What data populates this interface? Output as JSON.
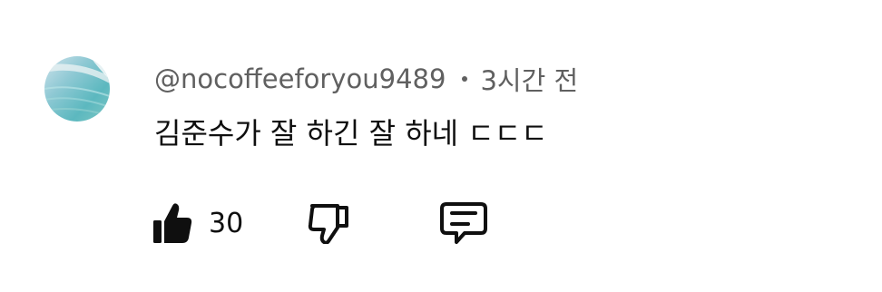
{
  "comment": {
    "author": "@nocoffeeforyou9489",
    "time": "3시간 전",
    "text": "김준수가 잘 하긴 잘 하네 ㄷㄷㄷ",
    "avatar_icon": "beach-water-avatar"
  },
  "actions": {
    "like_icon": "thumbs-up-icon",
    "like_count": "30",
    "dislike_icon": "thumbs-down-icon",
    "reply_icon": "comment-reply-icon"
  },
  "colors": {
    "text_primary": "#0f0f0f",
    "text_secondary": "#606060",
    "background": "#ffffff"
  }
}
